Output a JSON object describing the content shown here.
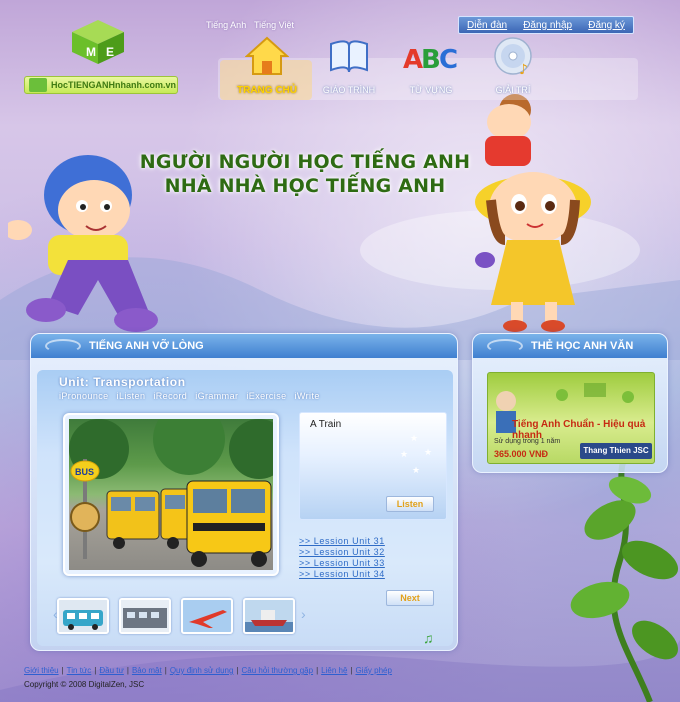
{
  "site": {
    "logo_text": "HocTIENGANHnhanh.com.vn"
  },
  "languages": [
    "Tiếng Anh",
    "Tiếng Việt"
  ],
  "top_links": [
    "Diễn đàn",
    "Đăng nhập",
    "Đăng ký"
  ],
  "nav": [
    {
      "label": "TRANG CHỦ",
      "icon": "house-icon",
      "active": true
    },
    {
      "label": "GIÁO TRÌNH",
      "icon": "book-icon",
      "active": false
    },
    {
      "label": "TỪ VỰNG",
      "icon": "abc-icon",
      "active": false
    },
    {
      "label": "GIẢI TRÍ",
      "icon": "cd-icon",
      "active": false
    }
  ],
  "slogan": {
    "line1": "NGƯỜI NGƯỜI HỌC TIẾNG ANH",
    "line2": "NHÀ NHÀ HỌC TIẾNG ANH"
  },
  "main_panel": {
    "title": "TIẾNG ANH VỠ LÒNG",
    "unit_title": "Unit: Transportation",
    "subtabs": [
      "iPronounce",
      "iListen",
      "iRecord",
      "iGrammar",
      "iExercise",
      "iWrite"
    ],
    "photo_sign": "BUS",
    "caption": "A Train",
    "listen_label": "Listen",
    "next_label": "Next",
    "lessons": [
      ">> Lession Unit 31",
      ">> Lession Unit 32",
      ">> Lession Unit 33",
      ">> Lession Unit 34"
    ],
    "thumbnails": [
      "bus-thumb",
      "train-thumb",
      "plane-thumb",
      "ship-thumb"
    ]
  },
  "side_panel": {
    "title": "THẺ HỌC ANH VĂN",
    "ad_headline": "Tiếng Anh Chuẩn - Hiệu quả nhanh",
    "ad_note": "Sử dụng trong 1 năm",
    "ad_price": "365.000 VNĐ",
    "ad_company": "Thang Thien JSC"
  },
  "footer": {
    "links": [
      "Giới thiệu",
      "Tin tức",
      "Đầu tư",
      "Bảo mật",
      "Quy định sử dụng",
      "Câu hỏi thường gặp",
      "Liên hệ",
      "Giấy phép"
    ],
    "copyright": "Copyright © 2008 DigitalZen, JSC"
  },
  "colors": {
    "accent": "#3f7fd0",
    "slogan": "#2e6b13",
    "active_nav": "#ffd200",
    "link": "#2f6cc6"
  }
}
